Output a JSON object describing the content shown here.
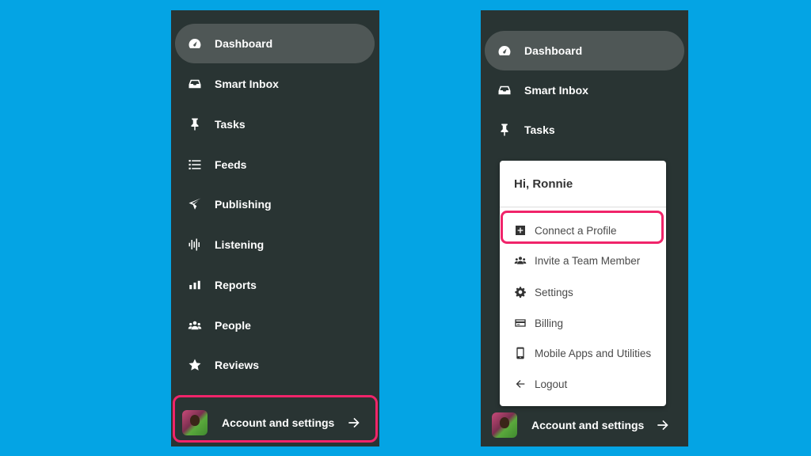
{
  "nav": {
    "items": [
      {
        "label": "Dashboard"
      },
      {
        "label": "Smart Inbox"
      },
      {
        "label": "Tasks"
      },
      {
        "label": "Feeds"
      },
      {
        "label": "Publishing"
      },
      {
        "label": "Listening"
      },
      {
        "label": "Reports"
      },
      {
        "label": "People"
      },
      {
        "label": "Reviews"
      }
    ],
    "account_label": "Account and settings"
  },
  "menu": {
    "greeting": "Hi, Ronnie",
    "items": [
      {
        "label": "Connect a Profile"
      },
      {
        "label": "Invite a Team Member"
      },
      {
        "label": "Settings"
      },
      {
        "label": "Billing"
      },
      {
        "label": "Mobile Apps and Utilities"
      },
      {
        "label": "Logout"
      }
    ]
  },
  "colors": {
    "background": "#04a4e4",
    "panel": "#293433",
    "active_item": "#4f5756",
    "highlight": "#f0246a"
  }
}
